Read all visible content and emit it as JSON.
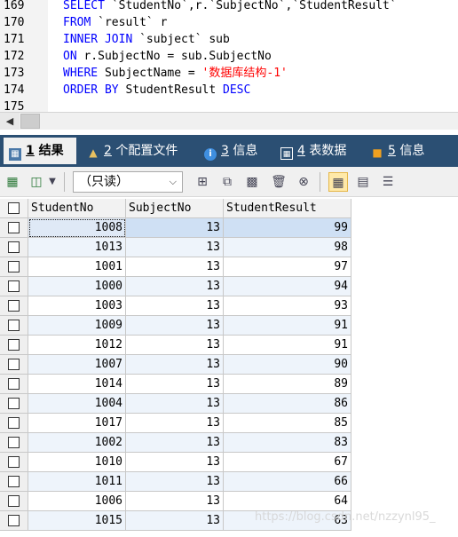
{
  "editor": {
    "lines": [
      {
        "no": "169",
        "tokens": [
          {
            "t": "SELECT ",
            "c": "kw"
          },
          {
            "t": "`StudentNo`,r.`SubjectNo`,`StudentResult`",
            "c": ""
          }
        ]
      },
      {
        "no": "170",
        "tokens": [
          {
            "t": "FROM ",
            "c": "kw"
          },
          {
            "t": "`result` r",
            "c": ""
          }
        ]
      },
      {
        "no": "171",
        "tokens": [
          {
            "t": "INNER JOIN ",
            "c": "kw"
          },
          {
            "t": "`subject` sub",
            "c": ""
          }
        ]
      },
      {
        "no": "172",
        "tokens": [
          {
            "t": "ON ",
            "c": "kw"
          },
          {
            "t": "r.SubjectNo = sub.SubjectNo",
            "c": ""
          }
        ]
      },
      {
        "no": "173",
        "tokens": [
          {
            "t": "WHERE ",
            "c": "kw"
          },
          {
            "t": "SubjectName = ",
            "c": ""
          },
          {
            "t": "'数据库结构-1'",
            "c": "str"
          }
        ]
      },
      {
        "no": "174",
        "tokens": [
          {
            "t": "ORDER BY ",
            "c": "kw"
          },
          {
            "t": "StudentResult ",
            "c": ""
          },
          {
            "t": "DESC",
            "c": "kw"
          }
        ]
      },
      {
        "no": "175",
        "tokens": []
      }
    ]
  },
  "tabs": [
    {
      "num": "1",
      "label": " 结果",
      "icon": "results-grid-icon",
      "active": true
    },
    {
      "num": "2",
      "label": " 个配置文件",
      "icon": "profile-icon",
      "active": false
    },
    {
      "num": "3",
      "label": " 信息",
      "icon": "info-icon",
      "active": false
    },
    {
      "num": "4",
      "label": " 表数据",
      "icon": "table-data-icon",
      "active": false
    },
    {
      "num": "5",
      "label": " 信息",
      "icon": "info-chart-icon",
      "active": false
    }
  ],
  "toolbar": {
    "mode_value": "（只读）"
  },
  "grid": {
    "columns": [
      "StudentNo",
      "SubjectNo",
      "StudentResult"
    ],
    "rows": [
      [
        "1008",
        "13",
        "99"
      ],
      [
        "1013",
        "13",
        "98"
      ],
      [
        "1001",
        "13",
        "97"
      ],
      [
        "1000",
        "13",
        "94"
      ],
      [
        "1003",
        "13",
        "93"
      ],
      [
        "1009",
        "13",
        "91"
      ],
      [
        "1012",
        "13",
        "91"
      ],
      [
        "1007",
        "13",
        "90"
      ],
      [
        "1014",
        "13",
        "89"
      ],
      [
        "1004",
        "13",
        "86"
      ],
      [
        "1017",
        "13",
        "85"
      ],
      [
        "1002",
        "13",
        "83"
      ],
      [
        "1010",
        "13",
        "67"
      ],
      [
        "1011",
        "13",
        "66"
      ],
      [
        "1006",
        "13",
        "64"
      ],
      [
        "1015",
        "13",
        "63"
      ]
    ]
  },
  "watermark": "https://blog.csdn.net/nzzynl95_",
  "colors": {
    "tabbar": "#2b4f73",
    "keyword": "#0000ff",
    "string": "#ff0000",
    "row_alt": "#eef4fb"
  }
}
